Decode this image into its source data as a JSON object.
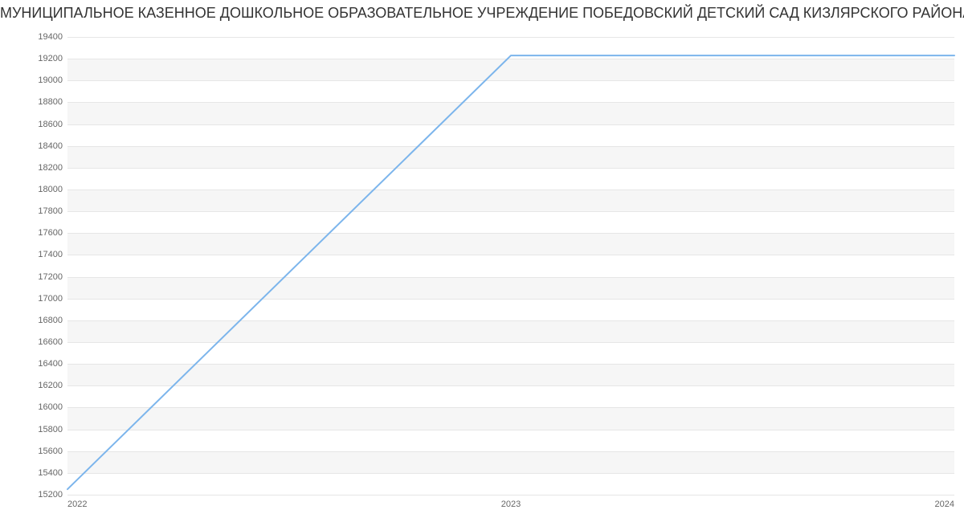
{
  "chart_data": {
    "type": "line",
    "title": "МУНИЦИПАЛЬНОЕ КАЗЕННОЕ ДОШКОЛЬНОЕ ОБРАЗОВАТЕЛЬНОЕ УЧРЕЖДЕНИЕ ПОБЕДОВСКИЙ ДЕТСКИЙ САД КИЗЛЯРСКОГО РАЙОНА РЕСПУБЛИКИ ДАГЕСТАН | Данные",
    "x": [
      2022,
      2023,
      2024
    ],
    "values": [
      15250,
      19230,
      19230
    ],
    "xlabel": "",
    "ylabel": "",
    "xlim": [
      2022,
      2024
    ],
    "ylim": [
      15200,
      19400
    ],
    "yticks": [
      15200,
      15400,
      15600,
      15800,
      16000,
      16200,
      16400,
      16600,
      16800,
      17000,
      17200,
      17400,
      17600,
      17800,
      18000,
      18200,
      18400,
      18600,
      18800,
      19000,
      19200,
      19400
    ],
    "xticks": [
      2022,
      2023,
      2024
    ],
    "xtick_labels": [
      "2022",
      "2023",
      "2024"
    ],
    "ytick_labels": [
      "15200",
      "15400",
      "15600",
      "15800",
      "16000",
      "16200",
      "16400",
      "16600",
      "16800",
      "17000",
      "17200",
      "17400",
      "17600",
      "17800",
      "18000",
      "18200",
      "18400",
      "18600",
      "18800",
      "19000",
      "19200",
      "19400"
    ],
    "series_color": "#7cb5ec"
  }
}
